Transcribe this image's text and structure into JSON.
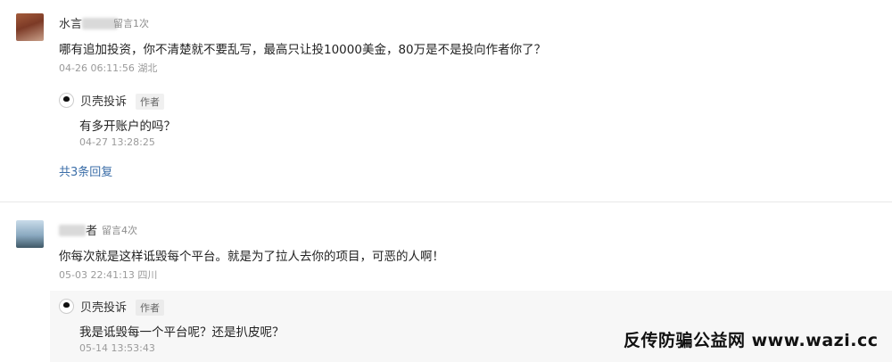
{
  "comments": [
    {
      "user_name": "水言",
      "message_count": "留言1次",
      "text": "哪有追加投资，你不清楚就不要乱写，最高只让投10000美金，80万是不是投向作者你了？",
      "timestamp": "04-26 06:11:56",
      "location": "湖北",
      "reply": {
        "author": "贝壳投诉",
        "badge": "作者",
        "text": "有多开账户的吗？",
        "timestamp": "04-27 13:28:25"
      },
      "more_replies": "共3条回复"
    },
    {
      "user_name": "者",
      "message_count": "留言4次",
      "text": "你每次就是这样诋毁每个平台。就是为了拉人去你的项目，可恶的人啊！",
      "timestamp": "05-03 22:41:13",
      "location": "四川",
      "reply": {
        "author": "贝壳投诉",
        "badge": "作者",
        "text": "我是诋毁每一个平台呢？还是扒皮呢？",
        "timestamp": "05-14 13:53:43"
      }
    }
  ],
  "watermark": "反传防骗公益网 www.wazi.cc"
}
